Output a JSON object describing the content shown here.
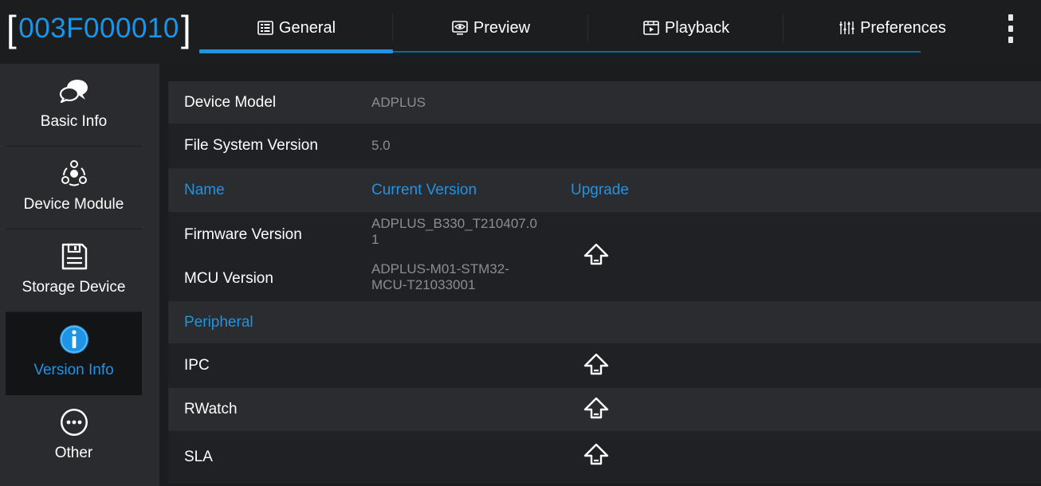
{
  "header": {
    "device_id": "003F000010",
    "bracket_left": "[",
    "bracket_right": "]",
    "tabs": [
      {
        "label": "General",
        "icon": "grid-icon",
        "active": true
      },
      {
        "label": "Preview",
        "icon": "monitor-eye-icon",
        "active": false
      },
      {
        "label": "Playback",
        "icon": "film-play-icon",
        "active": false
      },
      {
        "label": "Preferences",
        "icon": "sliders-icon",
        "active": false
      }
    ],
    "menu_icon": "more-vertical-icon"
  },
  "sidebar": {
    "items": [
      {
        "label": "Basic Info",
        "icon": "chat-bubbles-icon",
        "active": false
      },
      {
        "label": "Device Module",
        "icon": "module-nodes-icon",
        "active": false
      },
      {
        "label": "Storage Device",
        "icon": "floppy-disk-icon",
        "active": false
      },
      {
        "label": "Version Info",
        "icon": "info-icon",
        "active": true
      },
      {
        "label": "Other",
        "icon": "more-horizontal-icon",
        "active": false
      }
    ]
  },
  "main": {
    "device_model": {
      "label": "Device Model",
      "value": "ADPLUS"
    },
    "file_system": {
      "label": "File System Version",
      "value": "5.0"
    },
    "firmware_header": {
      "name": "Name",
      "current_version": "Current Version",
      "upgrade": "Upgrade"
    },
    "firmware": {
      "label": "Firmware Version",
      "value_line1": "ADPLUS_B330_T210407.0",
      "value_line2": "1"
    },
    "mcu": {
      "label": "MCU Version",
      "value_line1": "ADPLUS-M01-STM32-",
      "value_line2": "MCU-T21033001"
    },
    "peripheral_header": "Peripheral",
    "peripherals": [
      {
        "label": "IPC"
      },
      {
        "label": "RWatch"
      },
      {
        "label": "SLA"
      }
    ],
    "upgrade_icon": "upload-arrow-icon"
  },
  "colors": {
    "accent": "#1e94e6",
    "background": "#1b1c1e",
    "sidebar": "#2a2b2e",
    "row_light": "#2b2c2f",
    "row_dark": "#202124",
    "muted_text": "#8c8d90"
  }
}
